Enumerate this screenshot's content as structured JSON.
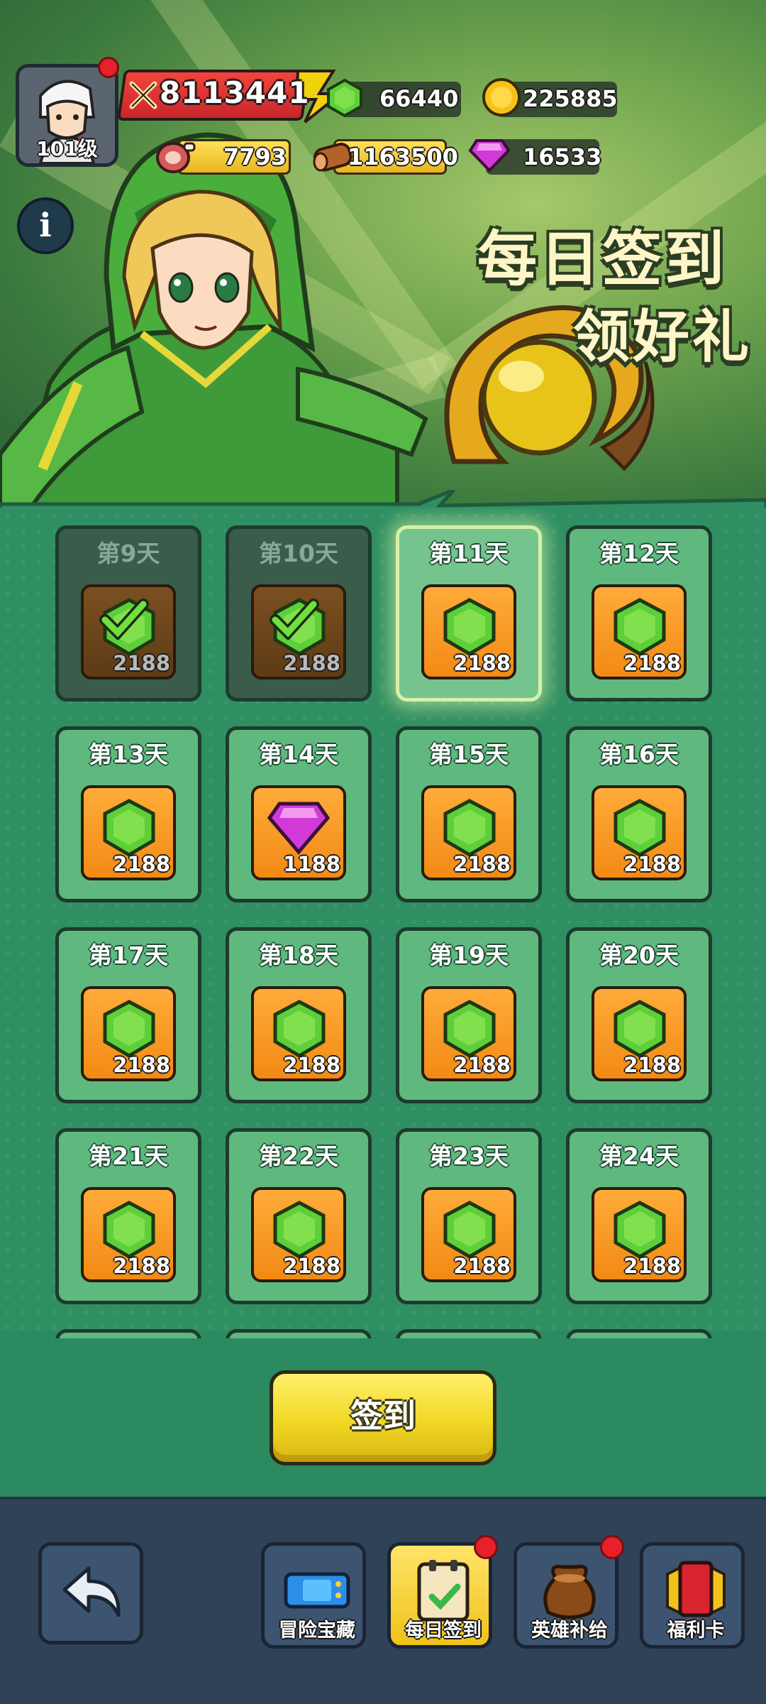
{
  "player": {
    "level": "101级"
  },
  "resources": {
    "power": "8113441",
    "green_gem": "66440",
    "gold": "225885",
    "meat": "7793",
    "wood": "1163500",
    "diamond": "16533"
  },
  "banner": {
    "title_line1": "每日签到",
    "title_line2": "领好礼"
  },
  "days": [
    {
      "label": "第9天",
      "reward_icon": "green-gem-icon",
      "count": "2188",
      "state": "claimed"
    },
    {
      "label": "第10天",
      "reward_icon": "green-gem-icon",
      "count": "2188",
      "state": "claimed"
    },
    {
      "label": "第11天",
      "reward_icon": "green-gem-icon",
      "count": "2188",
      "state": "today"
    },
    {
      "label": "第12天",
      "reward_icon": "green-gem-icon",
      "count": "2188",
      "state": "locked"
    },
    {
      "label": "第13天",
      "reward_icon": "green-gem-icon",
      "count": "2188",
      "state": "locked"
    },
    {
      "label": "第14天",
      "reward_icon": "purple-diamond-icon",
      "count": "1188",
      "state": "locked"
    },
    {
      "label": "第15天",
      "reward_icon": "green-gem-icon",
      "count": "2188",
      "state": "locked"
    },
    {
      "label": "第16天",
      "reward_icon": "green-gem-icon",
      "count": "2188",
      "state": "locked"
    },
    {
      "label": "第17天",
      "reward_icon": "green-gem-icon",
      "count": "2188",
      "state": "locked"
    },
    {
      "label": "第18天",
      "reward_icon": "green-gem-icon",
      "count": "2188",
      "state": "locked"
    },
    {
      "label": "第19天",
      "reward_icon": "green-gem-icon",
      "count": "2188",
      "state": "locked"
    },
    {
      "label": "第20天",
      "reward_icon": "green-gem-icon",
      "count": "2188",
      "state": "locked"
    },
    {
      "label": "第21天",
      "reward_icon": "green-gem-icon",
      "count": "2188",
      "state": "locked"
    },
    {
      "label": "第22天",
      "reward_icon": "green-gem-icon",
      "count": "2188",
      "state": "locked"
    },
    {
      "label": "第23天",
      "reward_icon": "green-gem-icon",
      "count": "2188",
      "state": "locked"
    },
    {
      "label": "第24天",
      "reward_icon": "green-gem-icon",
      "count": "2188",
      "state": "locked"
    }
  ],
  "sign_button": {
    "label": "签到"
  },
  "nav": {
    "adventure_treasure": "冒险宝藏",
    "daily_signin": "每日签到",
    "hero_supply": "英雄补给",
    "welfare_card": "福利卡"
  },
  "colors": {
    "grid_bg": "#2f8e62",
    "card_bg": "#5fb97e",
    "tile_orange": "#f28a14",
    "gem_green": "#5ecf3a",
    "diamond_purple": "#d23ad8",
    "button_yellow": "#f1d824",
    "bottom_bar": "#2f4258",
    "badge_red": "#e8202a"
  }
}
